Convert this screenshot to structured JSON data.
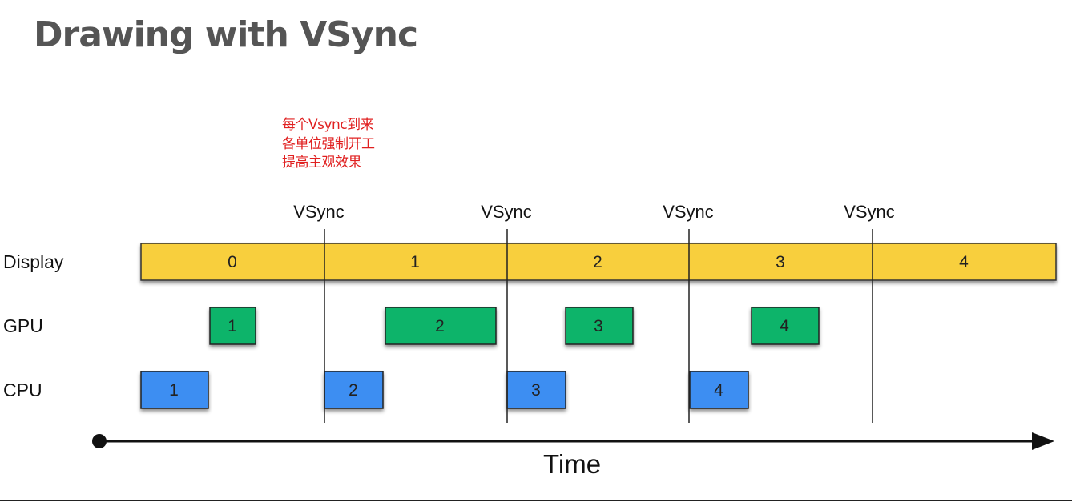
{
  "title": "Drawing with VSync",
  "annotation": {
    "line1": "每个Vsync到来",
    "line2": "各单位强制开工",
    "line3": "提高主观效果"
  },
  "colors": {
    "display": "#f8cf3c",
    "gpu": "#0fb46a",
    "cpu": "#3c8ef2",
    "annotation": "#e02020",
    "title": "#555555"
  },
  "diagram": {
    "vsync_label": "VSync",
    "vsync_count": 4,
    "rows": [
      {
        "key": "display",
        "label": "Display"
      },
      {
        "key": "gpu",
        "label": "GPU"
      },
      {
        "key": "cpu",
        "label": "CPU"
      }
    ],
    "display_frames": [
      "0",
      "1",
      "2",
      "3",
      "4"
    ],
    "gpu_blocks": [
      "1",
      "2",
      "3",
      "4"
    ],
    "cpu_blocks": [
      "1",
      "2",
      "3",
      "4"
    ],
    "axis_label": "Time"
  }
}
